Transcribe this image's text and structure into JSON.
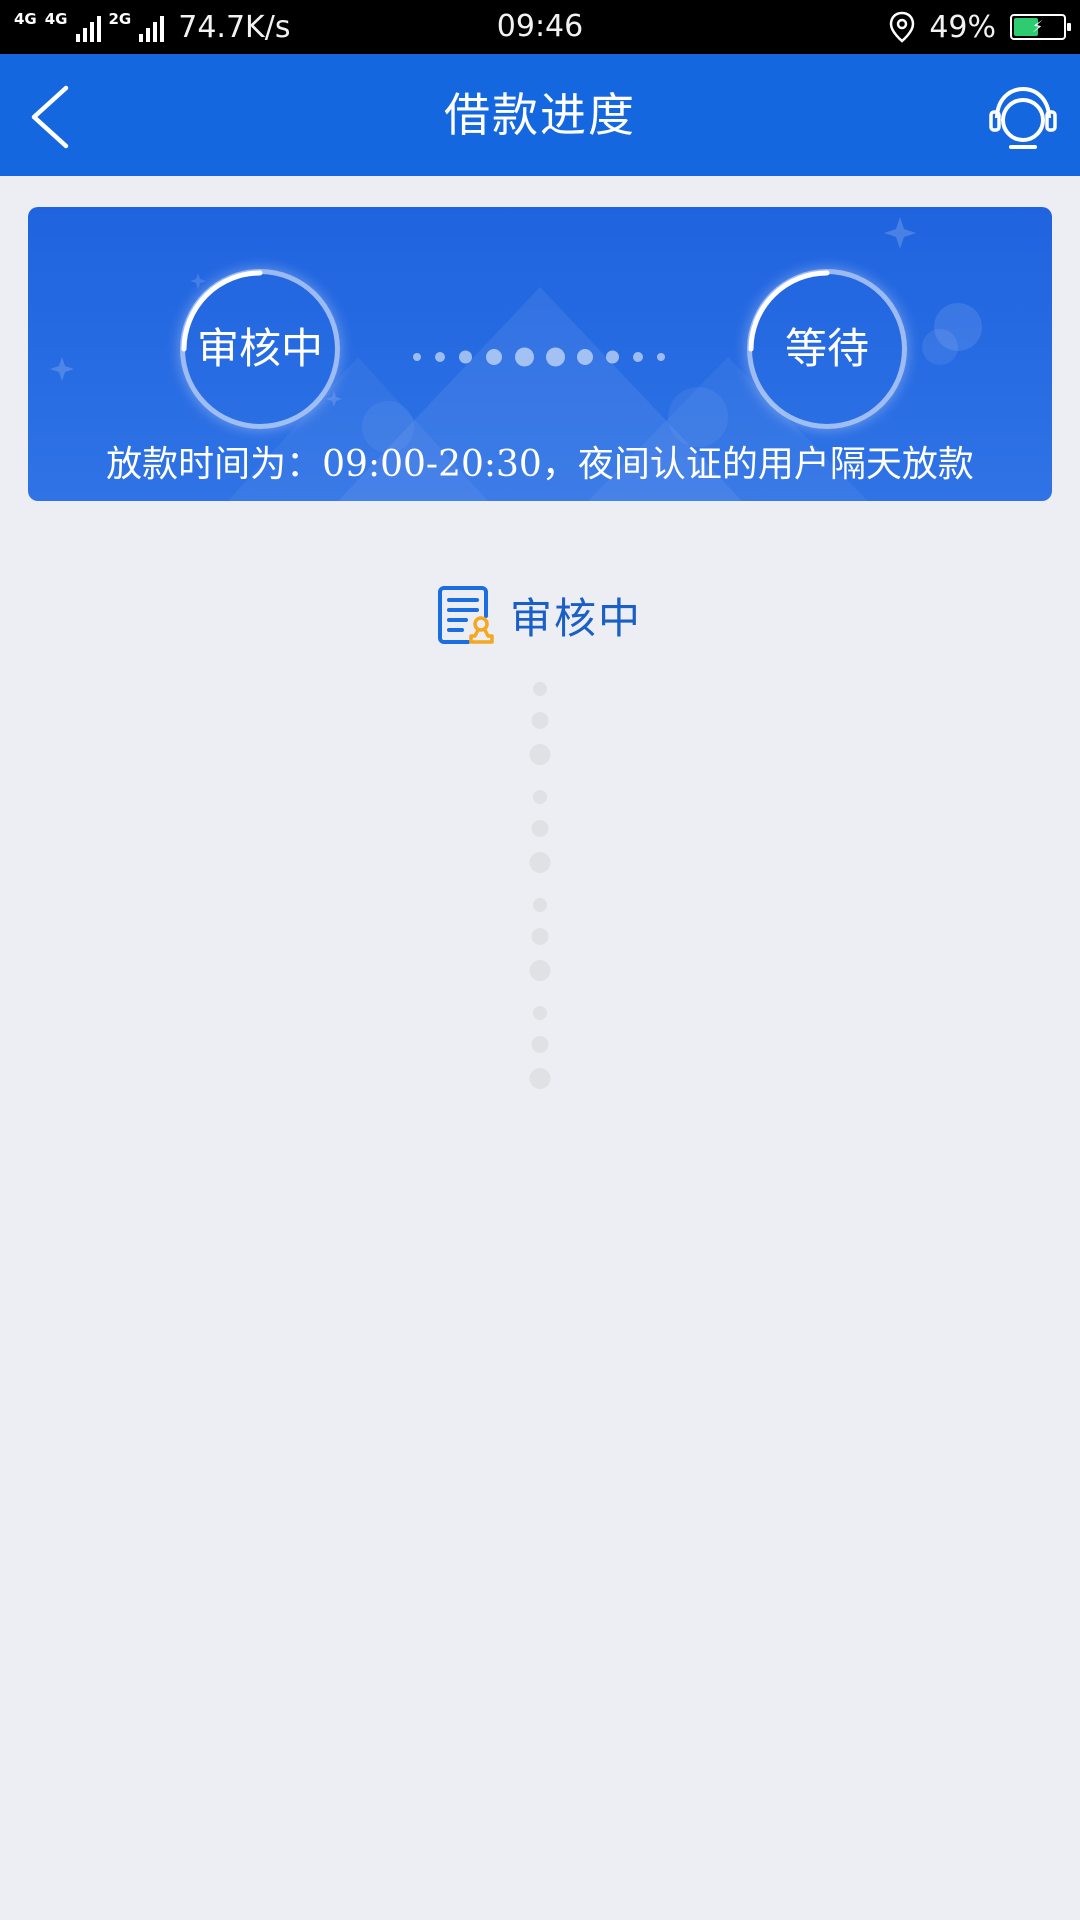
{
  "status_bar": {
    "net_left_label": "4G",
    "net_mid_label": "4G",
    "net_2g_label": "2G",
    "speed": "74.7K/s",
    "time": "09:46",
    "battery_percent": "49%",
    "battery_level": 0.49,
    "location_icon": "location-pin-icon"
  },
  "header": {
    "title": "借款进度",
    "back_icon": "chevron-left-icon",
    "support_icon": "headset-icon"
  },
  "banner": {
    "stages": [
      {
        "label": "审核中"
      },
      {
        "label": "等待"
      }
    ],
    "notice": "放款时间为：09:00-20:30，夜间认证的用户隔天放款"
  },
  "current_status": {
    "label": "审核中",
    "icon": "document-review-icon"
  },
  "colors": {
    "header_bg": "#1467df",
    "banner_bg": "#1f63df",
    "status_text": "#1a5fc6",
    "page_bg": "#edeef3",
    "accent_orange": "#f5a623"
  }
}
